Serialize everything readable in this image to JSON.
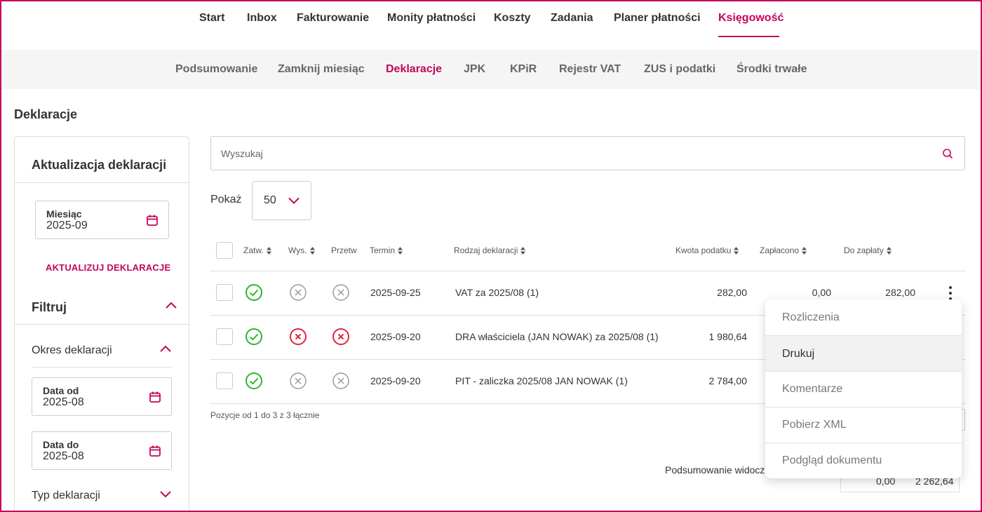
{
  "topnav": {
    "items": [
      {
        "label": "Start"
      },
      {
        "label": "Inbox"
      },
      {
        "label": "Fakturowanie"
      },
      {
        "label": "Monity płatności"
      },
      {
        "label": "Koszty"
      },
      {
        "label": "Zadania"
      },
      {
        "label": "Planer płatności"
      },
      {
        "label": "Księgowość",
        "active": true
      }
    ]
  },
  "subnav": {
    "items": [
      {
        "label": "Podsumowanie"
      },
      {
        "label": "Zamknij miesiąc"
      },
      {
        "label": "Deklaracje",
        "active": true
      },
      {
        "label": "JPK"
      },
      {
        "label": "KPiR"
      },
      {
        "label": "Rejestr VAT"
      },
      {
        "label": "ZUS i podatki"
      },
      {
        "label": "Środki trwałe"
      }
    ]
  },
  "page": {
    "title": "Deklaracje"
  },
  "sidebar": {
    "update_title": "Aktualizacja deklaracji",
    "month": {
      "label": "Miesiąc",
      "value": "2025-09"
    },
    "update_button": "AKTUALIZUJ DEKLARACJE",
    "filter_title": "Filtruj",
    "period": {
      "title": "Okres deklaracji",
      "date_from": {
        "label": "Data od",
        "value": "2025-08"
      },
      "date_to": {
        "label": "Data do",
        "value": "2025-08"
      }
    },
    "type_title": "Typ deklaracji"
  },
  "search": {
    "placeholder": "Wyszukaj"
  },
  "show": {
    "label": "Pokaż",
    "value": "50"
  },
  "table": {
    "headers": {
      "zatw": "Zatw.",
      "wys": "Wys.",
      "przetw": "Przetw",
      "termin": "Termin",
      "rodzaj": "Rodzaj deklaracji",
      "kwota": "Kwota podatku",
      "zaplacono": "Zapłacono",
      "do_zaplaty": "Do zapłaty"
    },
    "rows": [
      {
        "zatw": "ok",
        "wys": "none",
        "przetw": "none",
        "termin": "2025-09-25",
        "rodzaj": "VAT za 2025/08 (1)",
        "kwota": "282,00",
        "zaplacono": "0,00",
        "do_zaplaty": "282,00"
      },
      {
        "zatw": "ok",
        "wys": "error",
        "przetw": "error",
        "termin": "2025-09-20",
        "rodzaj": "DRA właściciela (JAN NOWAK) za 2025/08 (1)",
        "kwota": "1 980,64",
        "zaplacono": "",
        "do_zaplaty": ""
      },
      {
        "zatw": "ok",
        "wys": "none",
        "przetw": "none",
        "termin": "2025-09-20",
        "rodzaj": "PIT - zaliczka 2025/08 JAN NOWAK (1)",
        "kwota": "2 784,00",
        "zaplacono": "",
        "do_zaplaty": ""
      }
    ],
    "position_info": "Pozycje od 1 do 3 z 3 łącznie",
    "summary_label": "Podsumowanie widocz",
    "summary_values": {
      "zaplacono": "0,00",
      "do_zaplaty": "2 262,64"
    }
  },
  "context_menu": {
    "items": [
      {
        "label": "Rozliczenia"
      },
      {
        "label": "Drukuj",
        "hover": true
      },
      {
        "label": "Komentarze"
      },
      {
        "label": "Pobierz XML"
      },
      {
        "label": "Podgląd dokumentu"
      }
    ]
  },
  "colors": {
    "accent": "#c3065c",
    "ok": "#2db52d",
    "error": "#e0253a",
    "neutral": "#9a9a9a"
  }
}
